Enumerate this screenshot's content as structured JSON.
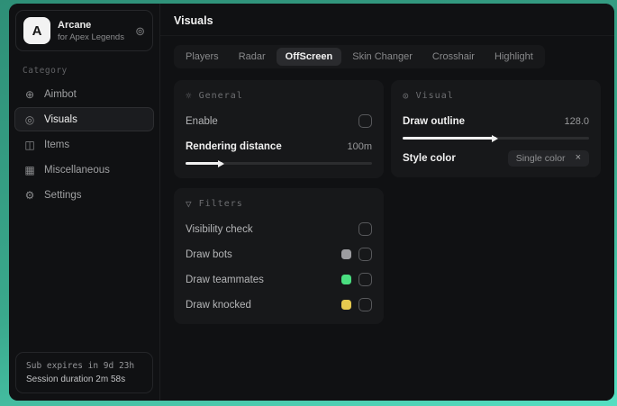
{
  "sidebar": {
    "logo": {
      "letter": "A",
      "title": "Arcane",
      "subtitle": "for Apex Legends"
    },
    "category_label": "Category",
    "items": [
      {
        "label": "Aimbot"
      },
      {
        "label": "Visuals"
      },
      {
        "label": "Items"
      },
      {
        "label": "Miscellaneous"
      },
      {
        "label": "Settings"
      }
    ],
    "footer": {
      "line1": "Sub expires in 9d 23h",
      "line2": "Session duration 2m 58s"
    }
  },
  "header": {
    "title": "Visuals"
  },
  "tabs": [
    {
      "label": "Players"
    },
    {
      "label": "Radar"
    },
    {
      "label": "OffScreen"
    },
    {
      "label": "Skin Changer"
    },
    {
      "label": "Crosshair"
    },
    {
      "label": "Highlight"
    }
  ],
  "panels": {
    "general": {
      "title": "General",
      "enable_label": "Enable",
      "enable_checked": false,
      "distance_label": "Rendering distance",
      "distance_value": "100m",
      "distance_percent": 20
    },
    "visual": {
      "title": "Visual",
      "outline_label": "Draw outline",
      "outline_value": "128.0",
      "outline_percent": 50,
      "style_label": "Style color",
      "style_value": "Single color"
    },
    "filters": {
      "title": "Filters",
      "rows": [
        {
          "label": "Visibility check",
          "swatch": "",
          "checked": false
        },
        {
          "label": "Draw bots",
          "swatch": "#9d9da1",
          "checked": false
        },
        {
          "label": "Draw teammates",
          "swatch": "#4ade80",
          "checked": false
        },
        {
          "label": "Draw knocked",
          "swatch": "#e6c94f",
          "checked": false
        }
      ]
    }
  },
  "icons": {
    "aimbot": "⊕",
    "visuals": "◎",
    "items": "◫",
    "miscellaneous": "▦",
    "settings": "⚙",
    "logo_corner": "⊚",
    "general": "☼",
    "visual": "⊙",
    "filters": "▽",
    "close": "×"
  },
  "colors": {
    "accent_teal": "#3aa88c",
    "swatch_bots": "#9d9da1",
    "swatch_teammates": "#4ade80",
    "swatch_knocked": "#e6c94f",
    "panel_bg": "#17181a",
    "window_bg": "#0f1012"
  }
}
